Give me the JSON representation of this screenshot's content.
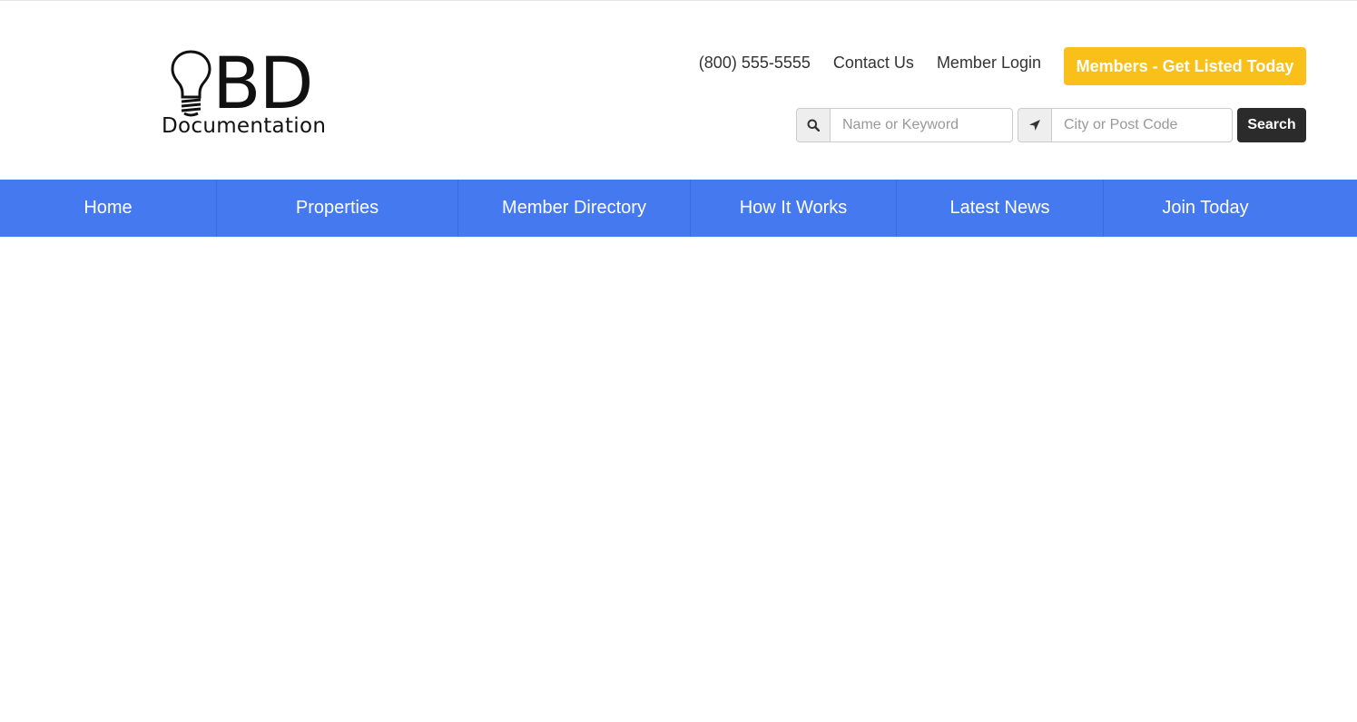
{
  "brand": {
    "logo_letters": "BD",
    "logo_word": "Documentation"
  },
  "header": {
    "phone": "(800) 555-5555",
    "contact_label": "Contact Us",
    "login_label": "Member Login",
    "cta_label": "Members - Get Listed Today",
    "cta_color": "#f8c019"
  },
  "search": {
    "keyword_placeholder": "Name or Keyword",
    "keyword_icon": "search-icon",
    "location_placeholder": "City or Post Code",
    "location_icon": "location-arrow-icon",
    "button_label": "Search"
  },
  "nav": {
    "color": "#4479ef",
    "items": [
      {
        "label": "Home"
      },
      {
        "label": "Properties"
      },
      {
        "label": "Member Directory"
      },
      {
        "label": "How It Works"
      },
      {
        "label": "Latest News"
      },
      {
        "label": "Join Today"
      }
    ]
  }
}
